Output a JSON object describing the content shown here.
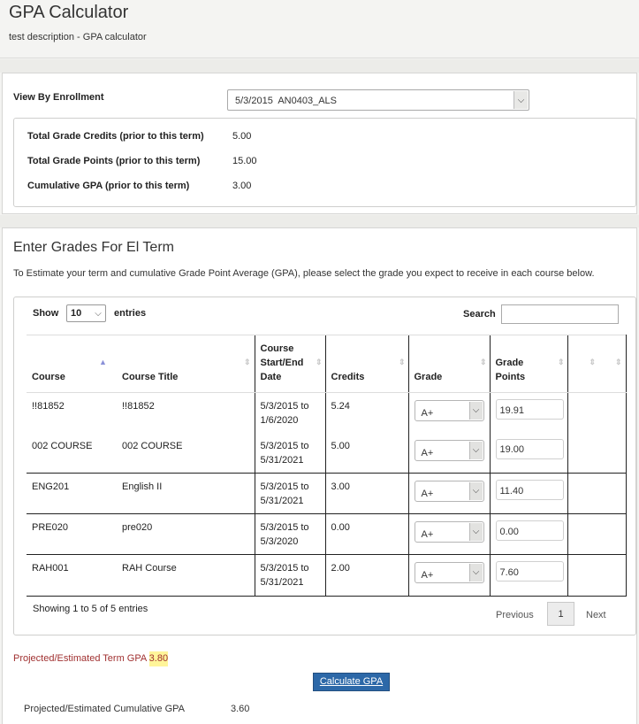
{
  "header": {
    "title": "GPA Calculator",
    "description": "test description - GPA calculator"
  },
  "enrollment": {
    "label": "View By Enrollment",
    "selected": "5/3/2015  AN0403_ALS",
    "arrow_icon": "chevron-down"
  },
  "summary": [
    {
      "label": "Total Grade Credits (prior to this term)",
      "value": "5.00"
    },
    {
      "label": "Total Grade Points (prior to this term)",
      "value": "15.00"
    },
    {
      "label": "Cumulative GPA (prior to this term)",
      "value": "3.00"
    }
  ],
  "grades_section": {
    "title": "Enter Grades For El Term",
    "description": "To Estimate your term and cumulative Grade Point Average (GPA), please select the grade you expect to receive in each course below."
  },
  "table_controls": {
    "show_label": "Show",
    "page_length": "10",
    "entries_label": "entries",
    "search_label": "Search",
    "search_value": ""
  },
  "table": {
    "columns": [
      {
        "label": "Course",
        "sort": "ascending"
      },
      {
        "label": "Course Title",
        "sort": "none"
      },
      {
        "label": "Course Start/End Date",
        "sort": "none"
      },
      {
        "label": "Credits",
        "sort": "none"
      },
      {
        "label": "Grade",
        "sort": "none"
      },
      {
        "label": "Grade Points",
        "sort": "none"
      },
      {
        "label": "",
        "sort": "none"
      }
    ],
    "rows": [
      {
        "course": "!!81852",
        "title": "!!81852",
        "dates": "5/3/2015 to 1/6/2020",
        "credits": "5.24",
        "grade": "A+",
        "grade_points": "19.91"
      },
      {
        "course": "002 COURSE",
        "title": "002 COURSE",
        "dates": "5/3/2015 to 5/31/2021",
        "credits": "5.00",
        "grade": "A+",
        "grade_points": "19.00"
      },
      {
        "course": "ENG201",
        "title": "English II",
        "dates": "5/3/2015 to 5/31/2021",
        "credits": "3.00",
        "grade": "A+",
        "grade_points": "11.40"
      },
      {
        "course": "PRE020",
        "title": "pre020",
        "dates": "5/3/2015 to 5/3/2020",
        "credits": "0.00",
        "grade": "A+",
        "grade_points": "0.00"
      },
      {
        "course": "RAH001",
        "title": "RAH Course",
        "dates": "5/3/2015 to 5/31/2021",
        "credits": "2.00",
        "grade": "A+",
        "grade_points": "7.60"
      }
    ]
  },
  "pagination": {
    "info": "Showing 1 to 5 of 5 entries",
    "previous": "Previous",
    "current": "1",
    "next": "Next"
  },
  "results": {
    "term_gpa_label": "Projected/Estimated Term GPA",
    "term_gpa_value": "3.80",
    "calculate_button": "Calculate GPA",
    "cumulative_gpa_label": "Projected/Estimated Cumulative GPA",
    "cumulative_gpa_value": "3.60"
  },
  "colors": {
    "button_bg": "#2c68a8",
    "term_gpa_text": "#a03030",
    "highlight": "#fff59a",
    "sort_active": "#8a90d8"
  }
}
